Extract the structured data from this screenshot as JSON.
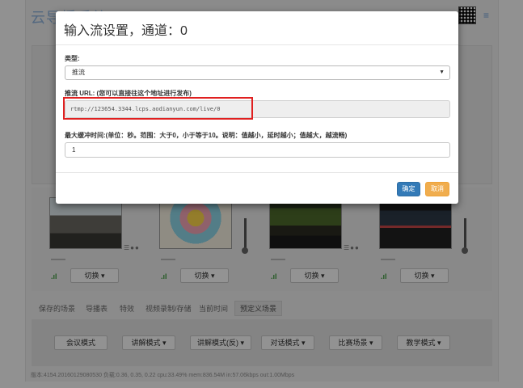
{
  "app": {
    "brand": "云导播系统",
    "menu_icon": "menu-icon"
  },
  "modal": {
    "title": "输入流设置，通道：0",
    "type_label": "类型:",
    "type_value": "推流",
    "url_label": "推流 URL: (您可以直接往这个地址进行发布)",
    "url_value": "rtmp://123654.3344.lcps.aodianyun.com/live/0",
    "buffer_label": "最大缓冲时间:(单位：秒。范围：大于0，小于等于10。说明：值越小，延时越小；值越大，越流畅)",
    "buffer_value": "1",
    "ok_label": "确定",
    "cancel_label": "取消"
  },
  "channels": [
    {
      "switch_label": "切换 ▾"
    },
    {
      "switch_label": "切换 ▾"
    },
    {
      "switch_label": "切换 ▾"
    },
    {
      "switch_label": "切换 ▾"
    }
  ],
  "tabs": [
    "保存的场景",
    "导播表",
    "特效",
    "视频录制/存储",
    "当前时间",
    "预定义场景"
  ],
  "scenes": [
    "会议模式",
    "讲解模式 ▾",
    "讲解模式(反) ▾",
    "对话模式 ▾",
    "比赛场景 ▾",
    "教学模式 ▾"
  ],
  "footer": "版本:4154.20160129080530  负载:0.36, 0.35, 0.22  cpu:33.49%  mem:836.54M  in:57.06kbps  out:1.00Mbps",
  "colors": {
    "accent": "#337ab7",
    "warning": "#f0ad4e",
    "highlight": "#e02020"
  }
}
